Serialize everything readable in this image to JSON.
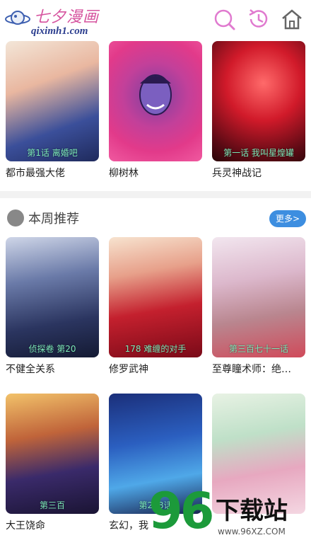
{
  "header": {
    "logo_cn": "七夕漫画",
    "logo_en": "qiximh1.com",
    "icons": [
      "search-icon",
      "history-icon",
      "home-icon"
    ],
    "accent": "#d6549f"
  },
  "top_row": [
    {
      "title": "都市最强大佬",
      "chapter": "第1话 离婚吧"
    },
    {
      "title": "柳树林",
      "chapter": ""
    },
    {
      "title": "兵灵神战记",
      "chapter": "第一话 我叫星煌罐"
    }
  ],
  "weekly": {
    "title": "本周推荐",
    "more": "更多>",
    "items": [
      {
        "title": "不健全关系",
        "chapter": "侦探卷 第20"
      },
      {
        "title": "修罗武神",
        "chapter": "178 难缠的对手"
      },
      {
        "title": "至尊瞳术师：绝…",
        "chapter": "第三百七十一话"
      },
      {
        "title": "大王饶命",
        "chapter": "第三百"
      },
      {
        "title": "玄幻，我",
        "chapter": "第278话"
      },
      {
        "title": "",
        "chapter": ""
      }
    ]
  },
  "watermark": {
    "num": "96",
    "text": "下载站",
    "url": "www.96XZ.COM"
  }
}
